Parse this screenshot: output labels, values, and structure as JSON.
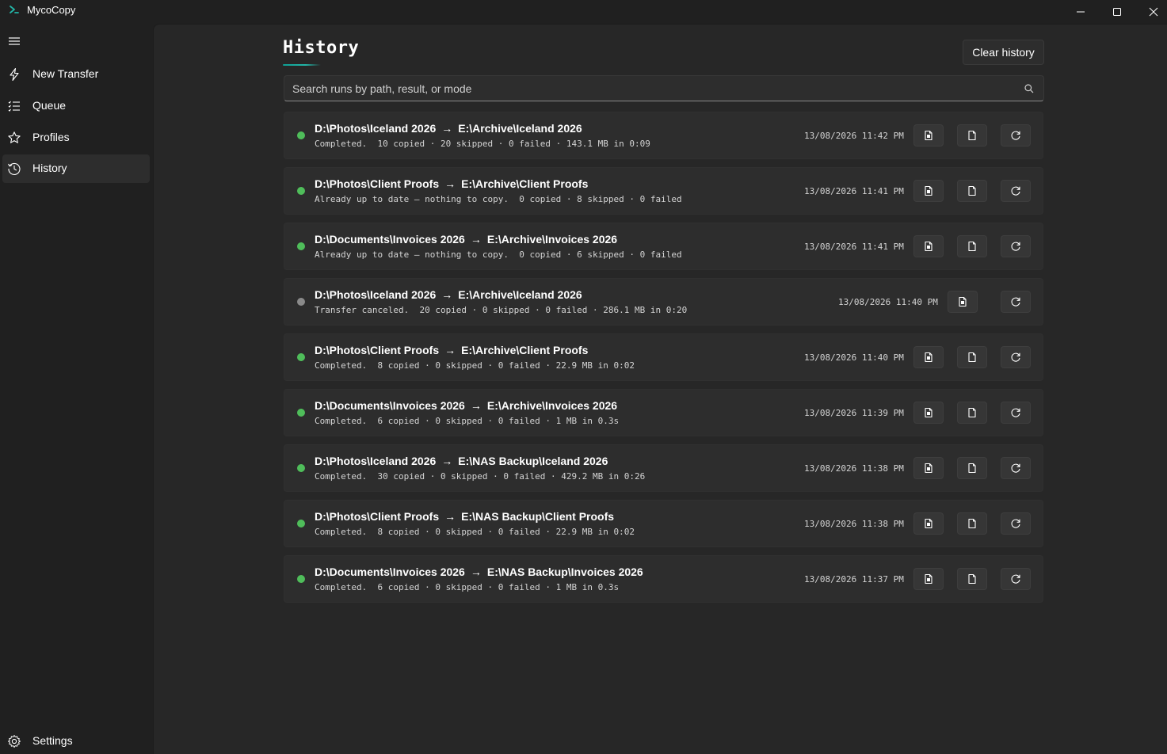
{
  "app": {
    "title": "MycoCopy",
    "accent": "#23b5a7"
  },
  "window_controls": {
    "minimize_icon": "minimize-icon",
    "maximize_icon": "maximize-icon",
    "close_icon": "close-icon"
  },
  "sidebar": {
    "menu_icon": "hamburger-icon",
    "items": [
      {
        "label": "New Transfer",
        "icon": "lightning-icon",
        "active": false
      },
      {
        "label": "Queue",
        "icon": "list-icon",
        "active": false
      },
      {
        "label": "Profiles",
        "icon": "star-icon",
        "active": false
      },
      {
        "label": "History",
        "icon": "history-icon",
        "active": true
      }
    ],
    "settings": {
      "label": "Settings",
      "icon": "gear-icon"
    }
  },
  "page": {
    "title": "History",
    "clear_button": "Clear history",
    "search_placeholder": "Search runs by path, result, or mode",
    "search_icon": "search-icon"
  },
  "status_colors": {
    "completed": "#4fbd5a",
    "canceled": "#8a8a8a"
  },
  "runs": [
    {
      "source": "D:\\Photos\\Iceland 2026",
      "dest": "E:\\Archive\\Iceland 2026",
      "detail": "Completed.  10 copied · 20 skipped · 0 failed · 143.1 MB in 0:09",
      "time": "13/08/2026 11:42 PM",
      "status": "completed"
    },
    {
      "source": "D:\\Photos\\Client Proofs",
      "dest": "E:\\Archive\\Client Proofs",
      "detail": "Already up to date — nothing to copy.  0 copied · 8 skipped · 0 failed",
      "time": "13/08/2026 11:41 PM",
      "status": "completed"
    },
    {
      "source": "D:\\Documents\\Invoices 2026",
      "dest": "E:\\Archive\\Invoices 2026",
      "detail": "Already up to date — nothing to copy.  0 copied · 6 skipped · 0 failed",
      "time": "13/08/2026 11:41 PM",
      "status": "completed"
    },
    {
      "source": "D:\\Photos\\Iceland 2026",
      "dest": "E:\\Archive\\Iceland 2026",
      "detail": "Transfer canceled.  20 copied · 0 skipped · 0 failed · 286.1 MB in 0:20",
      "time": "13/08/2026 11:40 PM",
      "status": "canceled"
    },
    {
      "source": "D:\\Photos\\Client Proofs",
      "dest": "E:\\Archive\\Client Proofs",
      "detail": "Completed.  8 copied · 0 skipped · 0 failed · 22.9 MB in 0:02",
      "time": "13/08/2026 11:40 PM",
      "status": "completed"
    },
    {
      "source": "D:\\Documents\\Invoices 2026",
      "dest": "E:\\Archive\\Invoices 2026",
      "detail": "Completed.  6 copied · 0 skipped · 0 failed · 1 MB in 0.3s",
      "time": "13/08/2026 11:39 PM",
      "status": "completed"
    },
    {
      "source": "D:\\Photos\\Iceland 2026",
      "dest": "E:\\NAS Backup\\Iceland 2026",
      "detail": "Completed.  30 copied · 0 skipped · 0 failed · 429.2 MB in 0:26",
      "time": "13/08/2026 11:38 PM",
      "status": "completed"
    },
    {
      "source": "D:\\Photos\\Client Proofs",
      "dest": "E:\\NAS Backup\\Client Proofs",
      "detail": "Completed.  8 copied · 0 skipped · 0 failed · 22.9 MB in 0:02",
      "time": "13/08/2026 11:38 PM",
      "status": "completed"
    },
    {
      "source": "D:\\Documents\\Invoices 2026",
      "dest": "E:\\NAS Backup\\Invoices 2026",
      "detail": "Completed.  6 copied · 0 skipped · 0 failed · 1 MB in 0.3s",
      "time": "13/08/2026 11:37 PM",
      "status": "completed"
    }
  ],
  "row_actions": {
    "arrow": "→",
    "report_icon": "report-icon",
    "log_icon": "log-file-icon",
    "rerun_icon": "rerun-icon"
  }
}
